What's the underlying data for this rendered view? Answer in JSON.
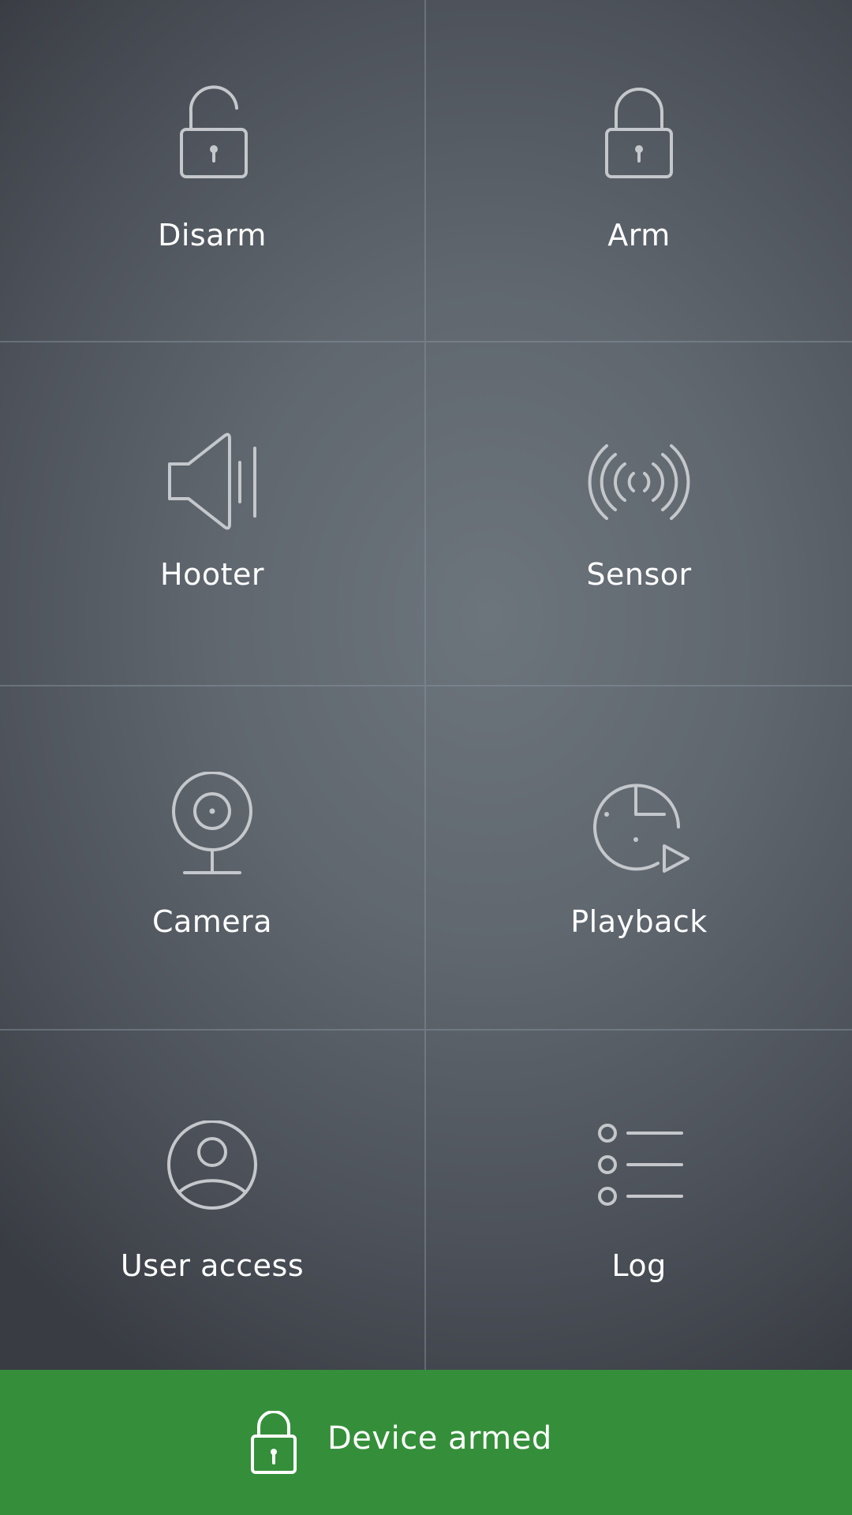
{
  "tiles": [
    {
      "label": "Disarm",
      "icon": "lock-open-icon"
    },
    {
      "label": "Arm",
      "icon": "lock-closed-icon"
    },
    {
      "label": "Hooter",
      "icon": "speaker-icon"
    },
    {
      "label": "Sensor",
      "icon": "signal-waves-icon"
    },
    {
      "label": "Camera",
      "icon": "webcam-icon"
    },
    {
      "label": "Playback",
      "icon": "clock-play-icon"
    },
    {
      "label": "User access",
      "icon": "user-circle-icon"
    },
    {
      "label": "Log",
      "icon": "list-icon"
    }
  ],
  "status": {
    "text": "Device armed",
    "icon": "lock-closed-icon",
    "color": "#358f3a"
  },
  "colors": {
    "icon_stroke": "#c4c7cb",
    "label_text": "#ffffff",
    "divider": "#8c96a0"
  }
}
